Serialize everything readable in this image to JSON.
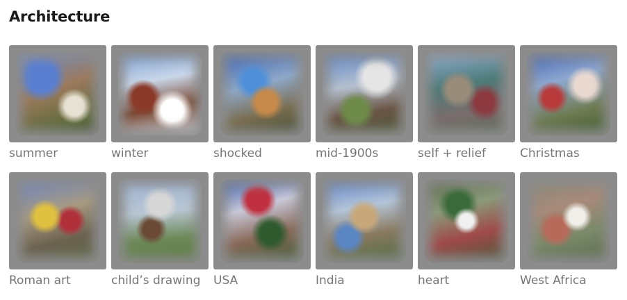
{
  "heading": "Architecture",
  "items": [
    {
      "label": "summer"
    },
    {
      "label": "winter"
    },
    {
      "label": "shocked"
    },
    {
      "label": "mid-1900s"
    },
    {
      "label": "self + relief"
    },
    {
      "label": "Christmas"
    },
    {
      "label": "Roman art"
    },
    {
      "label": "child’s drawing"
    },
    {
      "label": "USA"
    },
    {
      "label": "India"
    },
    {
      "label": "heart"
    },
    {
      "label": "West Africa"
    }
  ]
}
